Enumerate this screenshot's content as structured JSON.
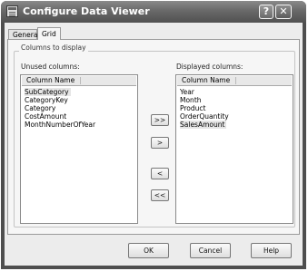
{
  "window": {
    "title": "Configure Data Viewer"
  },
  "tabs": {
    "general": "General",
    "grid": "Grid"
  },
  "group": {
    "label": "Columns to display"
  },
  "unused": {
    "label": "Unused columns:",
    "header": "Column Name",
    "items": [
      "SubCategory",
      "CategoryKey",
      "Category",
      "CostAmount",
      "MonthNumberOfYear"
    ]
  },
  "displayed": {
    "label": "Displayed columns:",
    "header": "Column Name",
    "items": [
      "Year",
      "Month",
      "Product",
      "OrderQuantity",
      "SalesAmount"
    ]
  },
  "move_buttons": {
    "add_all": ">>",
    "add": ">",
    "remove": "<",
    "remove_all": "<<"
  },
  "buttons": {
    "ok": "OK",
    "cancel": "Cancel",
    "help": "Help"
  },
  "caption": {
    "help": "?",
    "close": "✕"
  }
}
